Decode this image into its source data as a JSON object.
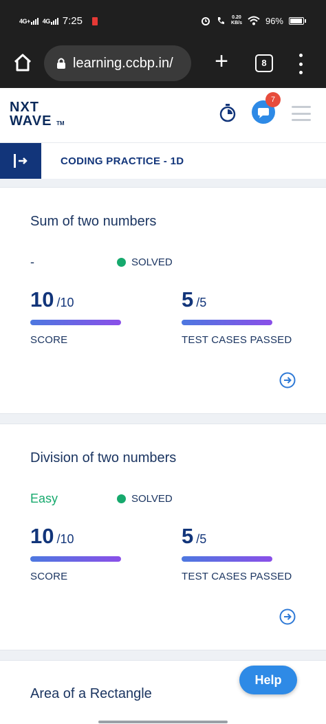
{
  "status_bar": {
    "network1": "4G+",
    "network2": "4G",
    "time": "7:25",
    "data_speed_value": "0.20",
    "data_speed_unit": "KB/s",
    "battery": "96%"
  },
  "browser": {
    "url": "learning.ccbp.in/",
    "tab_count": "8"
  },
  "header": {
    "logo_line1": "NXT",
    "logo_line2": "WAVE",
    "logo_tm": "TM",
    "notification_count": "7"
  },
  "practice": {
    "title": "CODING PRACTICE - 1D"
  },
  "questions": [
    {
      "title": "Sum of two numbers",
      "difficulty": "-",
      "status": "SOLVED",
      "score": "10",
      "score_total": "/10",
      "score_label": "SCORE",
      "tests": "5",
      "tests_total": "/5",
      "tests_label": "TEST CASES PASSED"
    },
    {
      "title": "Division of two numbers",
      "difficulty": "Easy",
      "status": "SOLVED",
      "score": "10",
      "score_total": "/10",
      "score_label": "SCORE",
      "tests": "5",
      "tests_total": "/5",
      "tests_label": "TEST CASES PASSED"
    },
    {
      "title": "Area of a Rectangle"
    }
  ],
  "help_label": "Help",
  "colors": {
    "brand_navy": "#12357a",
    "accent_blue": "#2e8ae6",
    "solved_green": "#16a96d",
    "easy_green": "#16a96d",
    "progress_start": "#4d78e0",
    "progress_end": "#8a4fe8"
  },
  "icons": [
    "home-icon",
    "lock-icon",
    "plus-icon",
    "tabs-icon",
    "more-icon",
    "timer-icon",
    "chat-icon",
    "menu-icon",
    "sidebar-toggle-icon",
    "arrow-right-icon"
  ]
}
